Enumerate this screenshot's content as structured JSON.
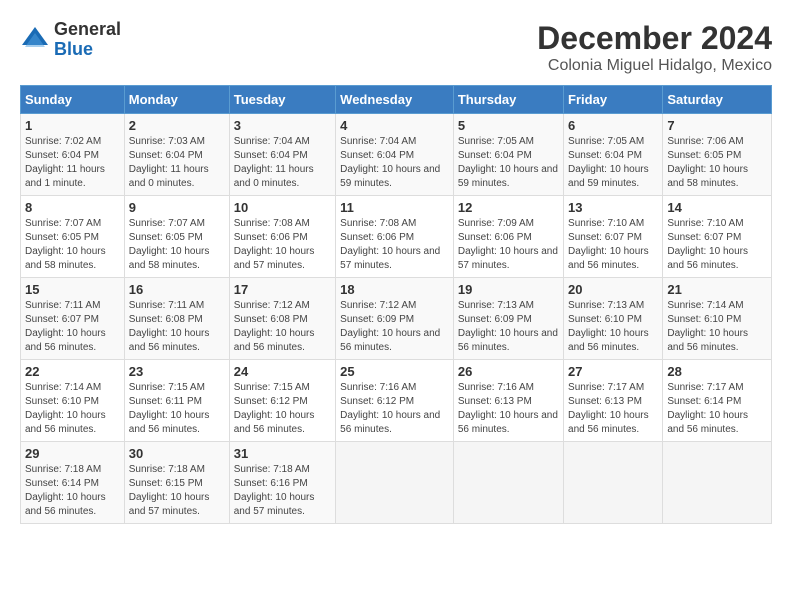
{
  "logo": {
    "general": "General",
    "blue": "Blue"
  },
  "title": "December 2024",
  "subtitle": "Colonia Miguel Hidalgo, Mexico",
  "calendar": {
    "headers": [
      "Sunday",
      "Monday",
      "Tuesday",
      "Wednesday",
      "Thursday",
      "Friday",
      "Saturday"
    ],
    "weeks": [
      [
        {
          "day": "1",
          "info": "Sunrise: 7:02 AM\nSunset: 6:04 PM\nDaylight: 11 hours and 1 minute."
        },
        {
          "day": "2",
          "info": "Sunrise: 7:03 AM\nSunset: 6:04 PM\nDaylight: 11 hours and 0 minutes."
        },
        {
          "day": "3",
          "info": "Sunrise: 7:04 AM\nSunset: 6:04 PM\nDaylight: 11 hours and 0 minutes."
        },
        {
          "day": "4",
          "info": "Sunrise: 7:04 AM\nSunset: 6:04 PM\nDaylight: 10 hours and 59 minutes."
        },
        {
          "day": "5",
          "info": "Sunrise: 7:05 AM\nSunset: 6:04 PM\nDaylight: 10 hours and 59 minutes."
        },
        {
          "day": "6",
          "info": "Sunrise: 7:05 AM\nSunset: 6:04 PM\nDaylight: 10 hours and 59 minutes."
        },
        {
          "day": "7",
          "info": "Sunrise: 7:06 AM\nSunset: 6:05 PM\nDaylight: 10 hours and 58 minutes."
        }
      ],
      [
        {
          "day": "8",
          "info": "Sunrise: 7:07 AM\nSunset: 6:05 PM\nDaylight: 10 hours and 58 minutes."
        },
        {
          "day": "9",
          "info": "Sunrise: 7:07 AM\nSunset: 6:05 PM\nDaylight: 10 hours and 58 minutes."
        },
        {
          "day": "10",
          "info": "Sunrise: 7:08 AM\nSunset: 6:06 PM\nDaylight: 10 hours and 57 minutes."
        },
        {
          "day": "11",
          "info": "Sunrise: 7:08 AM\nSunset: 6:06 PM\nDaylight: 10 hours and 57 minutes."
        },
        {
          "day": "12",
          "info": "Sunrise: 7:09 AM\nSunset: 6:06 PM\nDaylight: 10 hours and 57 minutes."
        },
        {
          "day": "13",
          "info": "Sunrise: 7:10 AM\nSunset: 6:07 PM\nDaylight: 10 hours and 56 minutes."
        },
        {
          "day": "14",
          "info": "Sunrise: 7:10 AM\nSunset: 6:07 PM\nDaylight: 10 hours and 56 minutes."
        }
      ],
      [
        {
          "day": "15",
          "info": "Sunrise: 7:11 AM\nSunset: 6:07 PM\nDaylight: 10 hours and 56 minutes."
        },
        {
          "day": "16",
          "info": "Sunrise: 7:11 AM\nSunset: 6:08 PM\nDaylight: 10 hours and 56 minutes."
        },
        {
          "day": "17",
          "info": "Sunrise: 7:12 AM\nSunset: 6:08 PM\nDaylight: 10 hours and 56 minutes."
        },
        {
          "day": "18",
          "info": "Sunrise: 7:12 AM\nSunset: 6:09 PM\nDaylight: 10 hours and 56 minutes."
        },
        {
          "day": "19",
          "info": "Sunrise: 7:13 AM\nSunset: 6:09 PM\nDaylight: 10 hours and 56 minutes."
        },
        {
          "day": "20",
          "info": "Sunrise: 7:13 AM\nSunset: 6:10 PM\nDaylight: 10 hours and 56 minutes."
        },
        {
          "day": "21",
          "info": "Sunrise: 7:14 AM\nSunset: 6:10 PM\nDaylight: 10 hours and 56 minutes."
        }
      ],
      [
        {
          "day": "22",
          "info": "Sunrise: 7:14 AM\nSunset: 6:10 PM\nDaylight: 10 hours and 56 minutes."
        },
        {
          "day": "23",
          "info": "Sunrise: 7:15 AM\nSunset: 6:11 PM\nDaylight: 10 hours and 56 minutes."
        },
        {
          "day": "24",
          "info": "Sunrise: 7:15 AM\nSunset: 6:12 PM\nDaylight: 10 hours and 56 minutes."
        },
        {
          "day": "25",
          "info": "Sunrise: 7:16 AM\nSunset: 6:12 PM\nDaylight: 10 hours and 56 minutes."
        },
        {
          "day": "26",
          "info": "Sunrise: 7:16 AM\nSunset: 6:13 PM\nDaylight: 10 hours and 56 minutes."
        },
        {
          "day": "27",
          "info": "Sunrise: 7:17 AM\nSunset: 6:13 PM\nDaylight: 10 hours and 56 minutes."
        },
        {
          "day": "28",
          "info": "Sunrise: 7:17 AM\nSunset: 6:14 PM\nDaylight: 10 hours and 56 minutes."
        }
      ],
      [
        {
          "day": "29",
          "info": "Sunrise: 7:18 AM\nSunset: 6:14 PM\nDaylight: 10 hours and 56 minutes."
        },
        {
          "day": "30",
          "info": "Sunrise: 7:18 AM\nSunset: 6:15 PM\nDaylight: 10 hours and 57 minutes."
        },
        {
          "day": "31",
          "info": "Sunrise: 7:18 AM\nSunset: 6:16 PM\nDaylight: 10 hours and 57 minutes."
        },
        {
          "day": "",
          "info": ""
        },
        {
          "day": "",
          "info": ""
        },
        {
          "day": "",
          "info": ""
        },
        {
          "day": "",
          "info": ""
        }
      ]
    ]
  }
}
